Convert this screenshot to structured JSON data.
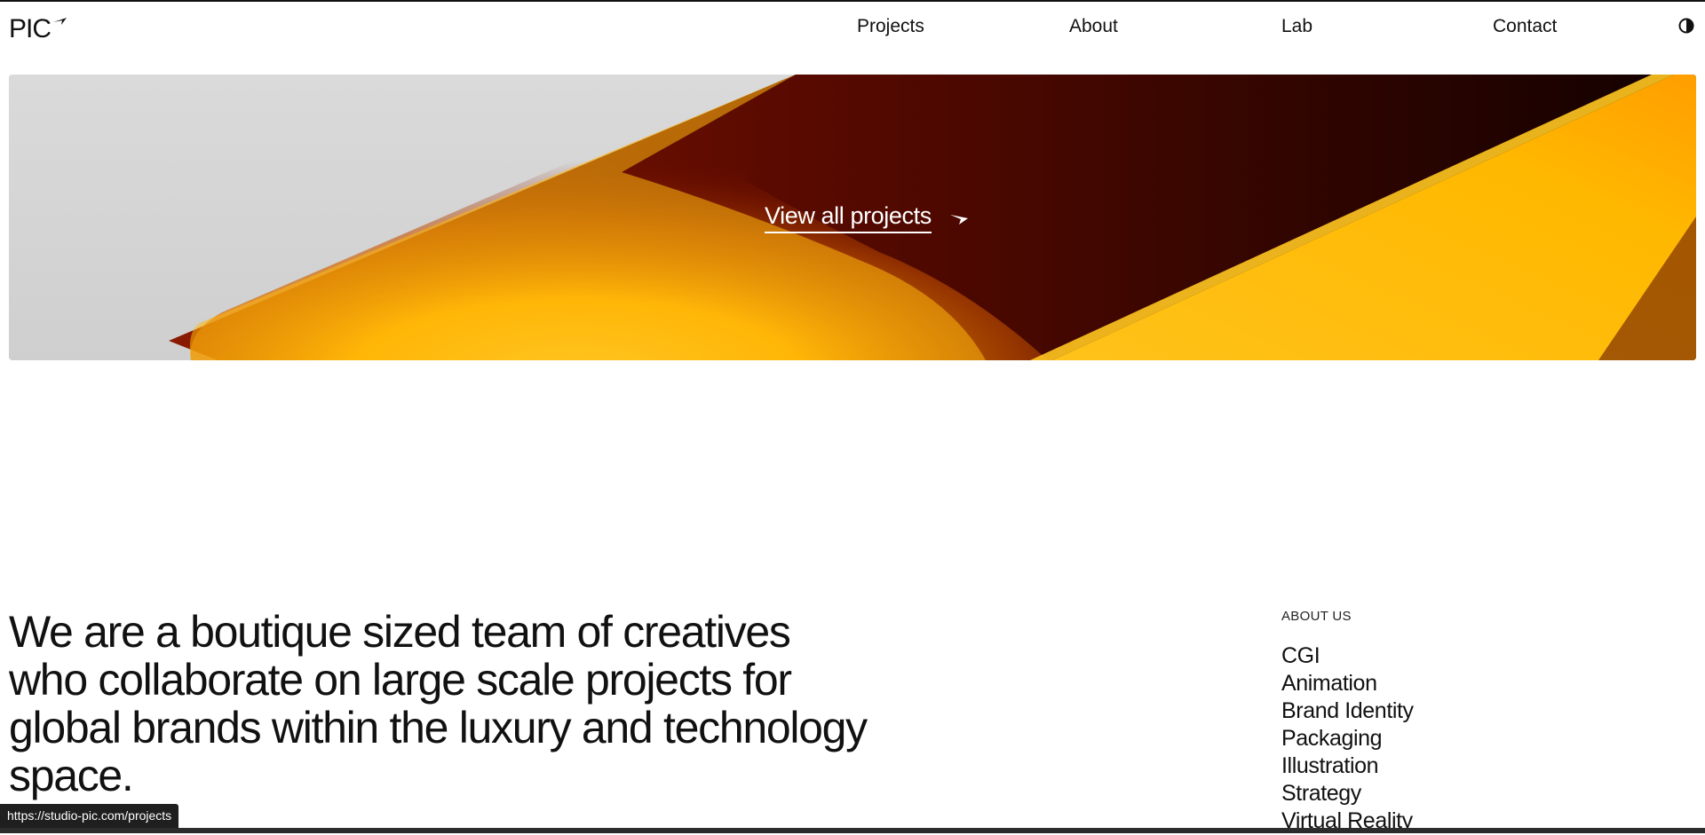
{
  "header": {
    "logo_text": "PIC",
    "nav": [
      "Projects",
      "About",
      "Lab",
      "Contact"
    ],
    "theme_toggle_icon": "half-circle-contrast-icon"
  },
  "hero": {
    "link_text": "View all projects",
    "link_icon": "arrow-right-icon",
    "colors": [
      "#d6d6d6",
      "#ffc21a",
      "#7a0f00",
      "#1a0300"
    ]
  },
  "intro": {
    "statement": "We are a boutique sized team of creatives who collaborate on large scale projects for global brands within the luxury and technology space.",
    "about_label": "ABOUT US",
    "services": [
      "CGI",
      "Animation",
      "Brand Identity",
      "Packaging",
      "Illustration",
      "Strategy",
      "Virtual Reality"
    ]
  },
  "browser": {
    "status_url": "https://studio-pic.com/projects"
  }
}
